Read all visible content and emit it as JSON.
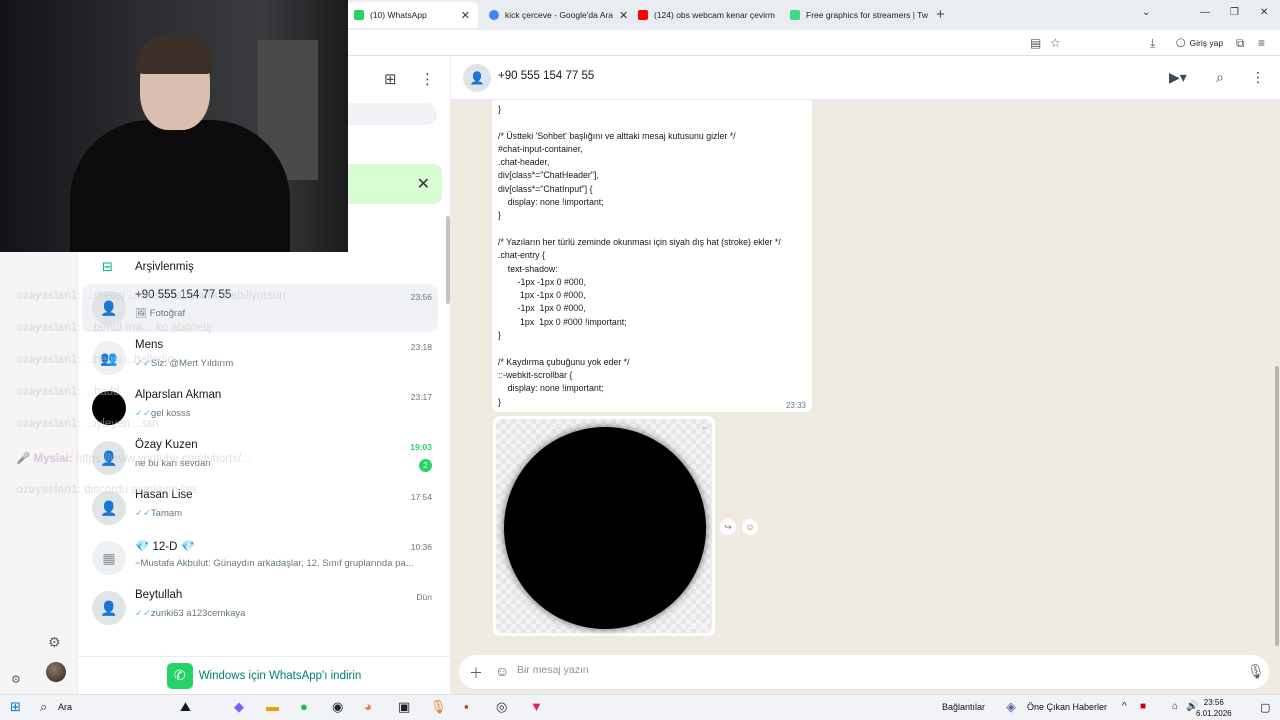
{
  "browser": {
    "tabs": [
      {
        "label": "(10) WhatsApp",
        "active": true,
        "favicon_color": "#25d366"
      },
      {
        "label": "kick çerceve - Google'da Ara",
        "favicon_color": "#4285f4"
      },
      {
        "label": "(124) obs webcam kenar çevirm",
        "favicon_color": "#ff0000"
      },
      {
        "label": "Free graphics for streamers | Tw",
        "favicon_color": "#3ddc84"
      }
    ],
    "login_label": "Giriş yap"
  },
  "chatlist": {
    "archived_label": "Arşivlenmiş",
    "items": [
      {
        "name": "+90 555 154 77 55",
        "time": "23:56",
        "preview": "Fotoğraf",
        "selected": true
      },
      {
        "name": "Mens",
        "time": "23:18",
        "preview": "Siz: @Mert Yıldırım"
      },
      {
        "name": "Alparslan Akman",
        "time": "23:17",
        "preview": "gel kosss"
      },
      {
        "name": "Özay Kuzen",
        "time": "19:03",
        "preview": "ne bu karı sevdan",
        "unread": "2"
      },
      {
        "name": "Hasan Lise",
        "time": "17:54",
        "preview": "Tamam"
      },
      {
        "name": "💎 12-D 💎",
        "time": "10:36",
        "preview": "~Mustafa Akbulut: Günaydın arkadaşlar, 12. Sınıf gruplarında pa..."
      },
      {
        "name": "Beytullah",
        "time": "Dün",
        "preview": "zuriki63 a123cemkaya"
      }
    ],
    "download_label": "Windows için WhatsApp'ı indirin"
  },
  "conversation": {
    "contact": "+90 555 154 77 55",
    "code_lines": [
      "}",
      "",
      "/* Üstteki 'Sohbet' başlığını ve alttaki mesaj kutusunu gizler */",
      "#chat-input-container,",
      ".chat-header,",
      "div[class*=\"ChatHeader\"],",
      "div[class*=\"ChatInput\"] {",
      "    display: none !important;",
      "}",
      "",
      "/* Yazıların her türlü zeminde okunması için siyah dış hat (stroke) ekler */",
      ".chat-entry {",
      "    text-shadow:",
      "        -1px -1px 0 #000,",
      "         1px -1px 0 #000,",
      "        -1px  1px 0 #000,",
      "         1px  1px 0 #000 !important;",
      "}",
      "",
      "/* Kaydırma çubuğunu yok eder */",
      "::-webkit-scrollbar {",
      "    display: none !important;",
      "}"
    ],
    "code_time": "23:33",
    "media_time": "23:56",
    "composer_placeholder": "Bir mesaj yazın"
  },
  "stream_overlay": {
    "messages": [
      {
        "user": "ozayaslan1:",
        "text": "...mesaj ...kliksen abonelik alabiliyorsun"
      },
      {
        "user": "ozayaslan1:",
        "text": "...tamdl mik ...ko abonelij"
      },
      {
        "user": "ozayaslan1:",
        "text": "...hepsi ...halledin"
      },
      {
        "user": "ozayaslan1:",
        "text": "...hadd"
      },
      {
        "user": "ozayaslan1:",
        "text": "...iyleyen ...tan"
      },
      {
        "user": "Mysiai:",
        "text": "https://www.youtube.com/shorts/...",
        "purple": true
      },
      {
        "user": "ozayaslan1:",
        "text": "discordu ayarlayın laa"
      }
    ]
  },
  "taskbar": {
    "search_label": "Ara",
    "connections_label": "Bağlantılar",
    "news_label": "Öne Çıkan Haberler",
    "time": "23:56",
    "date": "6.01.2026"
  },
  "colors": {
    "wa_green": "#25d366",
    "wa_dark_green": "#008069",
    "chat_bg": "#efeae2",
    "tick_blue": "#53bdeb"
  }
}
